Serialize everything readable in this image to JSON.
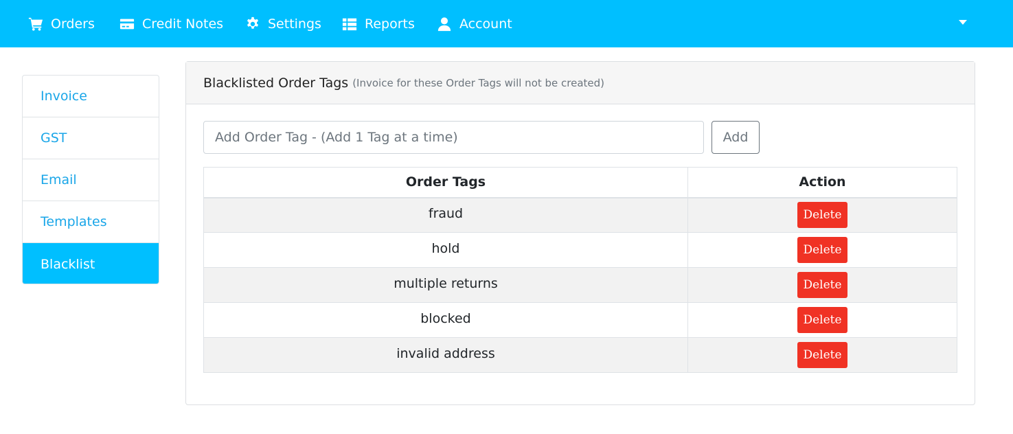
{
  "nav": {
    "items": [
      {
        "label": "Orders",
        "icon": "cart-icon"
      },
      {
        "label": "Credit Notes",
        "icon": "credit-card-icon"
      },
      {
        "label": "Settings",
        "icon": "gear-icon"
      },
      {
        "label": "Reports",
        "icon": "table-list-icon"
      },
      {
        "label": "Account",
        "icon": "user-icon"
      }
    ],
    "color": "#00bfff"
  },
  "sidebar": {
    "items": [
      {
        "label": "Invoice",
        "active": false
      },
      {
        "label": "GST",
        "active": false
      },
      {
        "label": "Email",
        "active": false
      },
      {
        "label": "Templates",
        "active": false
      },
      {
        "label": "Blacklist",
        "active": true
      }
    ]
  },
  "card": {
    "title": "Blacklisted Order Tags",
    "subtitle": "(Invoice for these Order Tags will not be created)",
    "input_placeholder": "Add Order Tag - (Add 1 Tag at a time)",
    "add_label": "Add"
  },
  "table": {
    "headers": [
      "Order Tags",
      "Action"
    ],
    "rows": [
      {
        "tag": "fraud",
        "action": "Delete"
      },
      {
        "tag": "hold",
        "action": "Delete"
      },
      {
        "tag": "multiple returns",
        "action": "Delete"
      },
      {
        "tag": "blocked",
        "action": "Delete"
      },
      {
        "tag": "invalid address",
        "action": "Delete"
      }
    ]
  },
  "colors": {
    "accent": "#00bfff",
    "danger": "#f03224"
  }
}
